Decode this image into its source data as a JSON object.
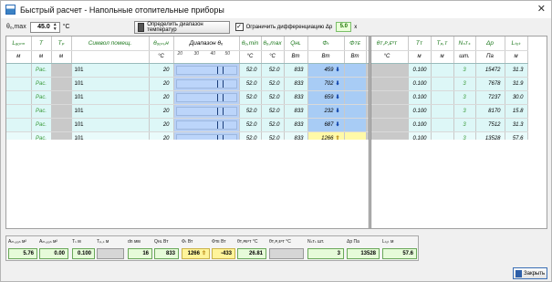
{
  "window": {
    "title": "Быстрый расчет - Напольные отопительные приборы",
    "close_glyph": "✕"
  },
  "toolbar": {
    "tmax_label": "θₒ,max",
    "tmax_value": "45.0",
    "tmax_unit": "°C",
    "range_button": "Определить диапазон температур",
    "limit_checkbox": "✓",
    "limit_label": "Ограничить дифференциацию Δp",
    "limit_value": "5.0",
    "limit_unit": "x"
  },
  "grid": {
    "headers": [
      "Lₐₒₙₙ",
      "T",
      "Tₚ",
      "Символ помещ.",
      "θₒₒₙ,н",
      "Диапазон θₓ",
      "θₒ,min",
      "θₒ,max",
      "Qʜʟ",
      "Φₜ",
      "Φᴛᴇ",
      "θᴛ,ᴘ,ᴇˣᴛ",
      "Tᴛ",
      "Tₚ,ᴛ",
      "Nₛᴛₛ",
      "Δp",
      "Lₜₒₜ"
    ],
    "units": [
      "м",
      "м",
      "м",
      "",
      "°C",
      "",
      "°C",
      "°C",
      "Вт",
      "Вт",
      "Вт",
      "°C",
      "м",
      "м",
      "шт.",
      "Па",
      "м"
    ],
    "scale_ticks": [
      "20",
      "30",
      "40",
      "50"
    ],
    "rows": [
      {
        "t": "Рас.",
        "name": "101",
        "tin": "20",
        "tmin": "52.0",
        "tmax": "52.0",
        "q": "833",
        "phi": "459",
        "phi_dir": "down",
        "tr": "0.100",
        "n": "3",
        "dp": "15472",
        "ltot": "31.3"
      },
      {
        "t": "Рас.",
        "name": "101",
        "tin": "20",
        "tmin": "52.0",
        "tmax": "52.0",
        "q": "833",
        "phi": "702",
        "phi_dir": "down",
        "tr": "0.100",
        "n": "3",
        "dp": "7678",
        "ltot": "31.9"
      },
      {
        "t": "Рас.",
        "name": "101",
        "tin": "20",
        "tmin": "52.0",
        "tmax": "52.0",
        "q": "833",
        "phi": "659",
        "phi_dir": "down",
        "tr": "0.100",
        "n": "3",
        "dp": "7237",
        "ltot": "30.0"
      },
      {
        "t": "Рас.",
        "name": "101",
        "tin": "20",
        "tmin": "52.0",
        "tmax": "52.0",
        "q": "833",
        "phi": "232",
        "phi_dir": "down",
        "tr": "0.100",
        "n": "3",
        "dp": "8170",
        "ltot": "15.8"
      },
      {
        "t": "Рас.",
        "name": "101",
        "tin": "20",
        "tmin": "52.0",
        "tmax": "52.0",
        "q": "833",
        "phi": "687",
        "phi_dir": "down",
        "tr": "0.100",
        "n": "3",
        "dp": "7512",
        "ltot": "31.3"
      },
      {
        "t": "Рас.",
        "name": "101",
        "tin": "20",
        "tmin": "52.0",
        "tmax": "52.0",
        "q": "833",
        "phi": "1266",
        "phi_dir": "up",
        "tr": "0.100",
        "n": "3",
        "dp": "13528",
        "ltot": "57.6"
      }
    ]
  },
  "summary": {
    "labels": [
      "Aₘ,ₒₒₙ м²",
      "Aₘ,ₒₒₙ м²",
      "Tₛ м",
      "Tₚ,ₛ м",
      "dn мм",
      "Qʜʟ Вт",
      "Φₜ Вт",
      "Φᴛᴇ Вт",
      "θᴛ,ᴘᴇˣᴛ °C",
      "θᴛ,ᴘ,ᴇˣᴛ °C",
      "Nₛᴛₛ шт.",
      "Δp Па",
      "Lₜₒₜ м"
    ],
    "values": [
      "5.76",
      "0.00",
      "0.100",
      "",
      "16",
      "833",
      "1266",
      "-433",
      "26.81",
      "",
      "3",
      "13528",
      "57.6"
    ]
  },
  "footer": {
    "close_label": "Закрыть"
  }
}
